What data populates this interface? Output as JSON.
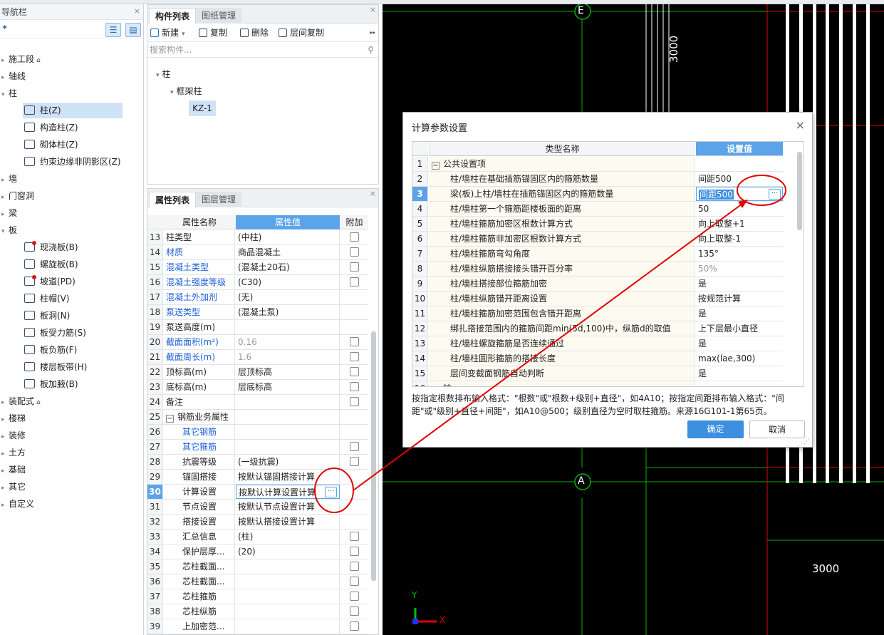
{
  "nav": {
    "title": "导航栏",
    "close": "×",
    "items": [
      {
        "label": "施工段",
        "arrow": "▸",
        "lock": true
      },
      {
        "label": "轴线",
        "arrow": "▸"
      },
      {
        "label": "柱",
        "arrow": "▾"
      },
      {
        "label": "墙",
        "arrow": "▸"
      },
      {
        "label": "门窗洞",
        "arrow": "▸"
      },
      {
        "label": "梁",
        "arrow": "▸"
      },
      {
        "label": "板",
        "arrow": "▾"
      },
      {
        "label": "装配式",
        "arrow": "▸",
        "lock": true
      },
      {
        "label": "楼梯",
        "arrow": "▸"
      },
      {
        "label": "装修",
        "arrow": "▸"
      },
      {
        "label": "土方",
        "arrow": "▸"
      },
      {
        "label": "基础",
        "arrow": "▸"
      },
      {
        "label": "其它",
        "arrow": "▸"
      },
      {
        "label": "自定义",
        "arrow": "▸"
      }
    ],
    "column_sub": [
      "柱(Z)",
      "构造柱(Z)",
      "砌体柱(Z)",
      "约束边缘非阴影区(Z)"
    ],
    "slab_sub": [
      "现浇板(B)",
      "螺旋板(B)",
      "坡道(PD)",
      "柱帽(V)",
      "板洞(N)",
      "板受力筋(S)",
      "板负筋(F)",
      "楼层板带(H)",
      "板加腋(B)"
    ]
  },
  "component": {
    "tabs": [
      "构件列表",
      "图纸管理"
    ],
    "toolbar": {
      "new": "新建",
      "copy": "复制",
      "delete": "删除",
      "floor_copy": "层间复制",
      "more": "▸▸"
    },
    "search_placeholder": "搜索构件...",
    "tree": {
      "root": "柱",
      "child": "框架柱",
      "leaf": "KZ-1"
    }
  },
  "property": {
    "tabs": [
      "属性列表",
      "图层管理"
    ],
    "headers": [
      "属性名称",
      "属性值",
      "附加"
    ],
    "rows": [
      {
        "n": "13",
        "name": "柱类型",
        "value": "(中柱)",
        "cb": true
      },
      {
        "n": "14",
        "name": "材质",
        "value": "商品混凝土",
        "cb": true,
        "blue": true
      },
      {
        "n": "15",
        "name": "混凝土类型",
        "value": "(混凝土20石)",
        "cb": true,
        "blue": true
      },
      {
        "n": "16",
        "name": "混凝土强度等级",
        "value": "(C30)",
        "cb": true,
        "blue": true
      },
      {
        "n": "17",
        "name": "混凝土外加剂",
        "value": "(无)",
        "blue": true
      },
      {
        "n": "18",
        "name": "泵送类型",
        "value": "(混凝土泵)",
        "blue": true
      },
      {
        "n": "19",
        "name": "泵送高度(m)",
        "value": ""
      },
      {
        "n": "20",
        "name": "截面面积(m²)",
        "value": "0.16",
        "cb": true,
        "blue": true,
        "grey": true
      },
      {
        "n": "21",
        "name": "截面周长(m)",
        "value": "1.6",
        "cb": true,
        "blue": true,
        "grey": true
      },
      {
        "n": "22",
        "name": "顶标高(m)",
        "value": "层顶标高",
        "cb": true
      },
      {
        "n": "23",
        "name": "底标高(m)",
        "value": "层底标高",
        "cb": true
      },
      {
        "n": "24",
        "name": "备注",
        "value": "",
        "cb": true
      },
      {
        "n": "25",
        "name": "钢筋业务属性",
        "value": "",
        "group": true
      },
      {
        "n": "26",
        "name": "其它钢筋",
        "value": "",
        "blue": true,
        "indent": true
      },
      {
        "n": "27",
        "name": "其它箍筋",
        "value": "",
        "cb": true,
        "blue": true,
        "indent": true
      },
      {
        "n": "28",
        "name": "抗震等级",
        "value": "(一级抗震)",
        "cb": true,
        "indent": true
      },
      {
        "n": "29",
        "name": "锚固搭接",
        "value": "按默认锚固搭接计算",
        "indent": true
      },
      {
        "n": "30",
        "name": "计算设置",
        "value": "按默认计算设置计算",
        "indent": true,
        "active": true
      },
      {
        "n": "31",
        "name": "节点设置",
        "value": "按默认节点设置计算",
        "indent": true
      },
      {
        "n": "32",
        "name": "搭接设置",
        "value": "按默认搭接设置计算",
        "indent": true
      },
      {
        "n": "33",
        "name": "汇总信息",
        "value": "(柱)",
        "cb": true,
        "indent": true
      },
      {
        "n": "34",
        "name": "保护层厚...",
        "value": "(20)",
        "cb": true,
        "indent": true
      },
      {
        "n": "35",
        "name": "芯柱截面...",
        "value": "",
        "cb": true,
        "indent": true
      },
      {
        "n": "36",
        "name": "芯柱截面...",
        "value": "",
        "cb": true,
        "indent": true
      },
      {
        "n": "37",
        "name": "芯柱箍筋",
        "value": "",
        "cb": true,
        "indent": true
      },
      {
        "n": "38",
        "name": "芯柱纵筋",
        "value": "",
        "cb": true,
        "indent": true
      },
      {
        "n": "39",
        "name": "上加密范...",
        "value": "",
        "cb": true,
        "indent": true
      }
    ]
  },
  "cad": {
    "labels": {
      "e": "E",
      "a": "A",
      "dim1": "3000",
      "dim2": "3000",
      "y": "Y",
      "x": "X"
    }
  },
  "dialog": {
    "title": "计算参数设置",
    "close": "×",
    "headers": [
      "类型名称",
      "设置值"
    ],
    "rows": [
      {
        "n": "1",
        "name": "公共设置项",
        "value": "",
        "group": true
      },
      {
        "n": "2",
        "name": "柱/墙柱在基础插筋锚固区内的箍筋数量",
        "value": "间距500"
      },
      {
        "n": "3",
        "name": "梁(板)上柱/墙柱在插筋锚固区内的箍筋数量",
        "value": "间距500",
        "active": true
      },
      {
        "n": "4",
        "name": "柱/墙柱第一个箍筋距楼板面的距离",
        "value": "50"
      },
      {
        "n": "5",
        "name": "柱/墙柱箍筋加密区根数计算方式",
        "value": "向上取整+1"
      },
      {
        "n": "6",
        "name": "柱/墙柱箍筋非加密区根数计算方式",
        "value": "向上取整-1"
      },
      {
        "n": "7",
        "name": "柱/墙柱箍筋弯勾角度",
        "value": "135°"
      },
      {
        "n": "8",
        "name": "柱/墙柱纵筋搭接接头错开百分率",
        "value": "50%",
        "grey": true
      },
      {
        "n": "9",
        "name": "柱/墙柱搭接部位箍筋加密",
        "value": "是"
      },
      {
        "n": "10",
        "name": "柱/墙柱纵筋错开距离设置",
        "value": "按规范计算"
      },
      {
        "n": "11",
        "name": "柱/墙柱箍筋加密范围包含错开距离",
        "value": "是"
      },
      {
        "n": "12",
        "name": "绑扎搭接范围内的箍筋间距min(5d,100)中，纵筋d的取值",
        "value": "上下层最小直径"
      },
      {
        "n": "13",
        "name": "柱/墙柱螺旋箍筋是否连续通过",
        "value": "是"
      },
      {
        "n": "14",
        "name": "柱/墙柱圆形箍筋的搭接长度",
        "value": "max(lae,300)"
      },
      {
        "n": "15",
        "name": "层间变截面钢筋自动判断",
        "value": "是"
      },
      {
        "n": "16",
        "name": "柱",
        "value": "",
        "group": true
      }
    ],
    "hint": "按指定根数排布输入格式：\"根数\"或\"根数+级别+直径\"，如4A10；按指定间距排布输入格式：\"间距\"或\"级别+直径+间距\"，如A10@500；级别直径为空时取柱箍筋。来源16G101-1第65页。",
    "ok": "确定",
    "cancel": "取消"
  },
  "colors": {
    "accent": "#3d8fe0",
    "annotation": "#e00000",
    "cad_green": "#00a000",
    "cad_red": "#e00000"
  }
}
